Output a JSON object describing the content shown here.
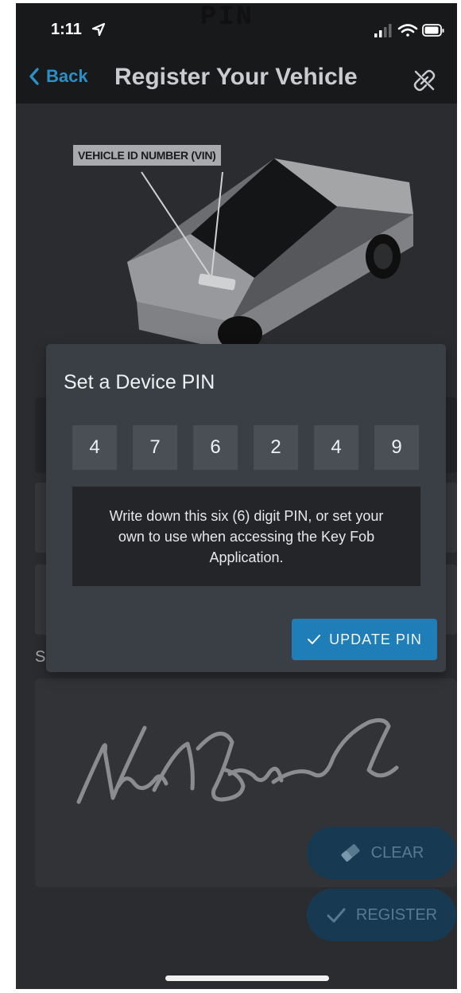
{
  "overlay_label": "PIN",
  "status_bar": {
    "time": "1:11"
  },
  "nav": {
    "back_label": "Back",
    "title": "Register Your Vehicle"
  },
  "diagram": {
    "vin_label": "VEHICLE ID NUMBER (VIN)"
  },
  "signature_section": {
    "label_fragment": "S"
  },
  "modal": {
    "title": "Set a Device PIN",
    "pin_digits": [
      "4",
      "7",
      "6",
      "2",
      "4",
      "9"
    ],
    "note": "Write down this six (6) digit PIN, or set your own to use when accessing the Key Fob Application.",
    "update_button_label": "UPDATE PIN"
  },
  "actions": {
    "clear_label": "CLEAR",
    "register_label": "REGISTER"
  },
  "colors": {
    "accent": "#1f7db8",
    "back_link": "#2d8fc4",
    "background": "#2a2c30",
    "modal": "#3a3e45"
  }
}
